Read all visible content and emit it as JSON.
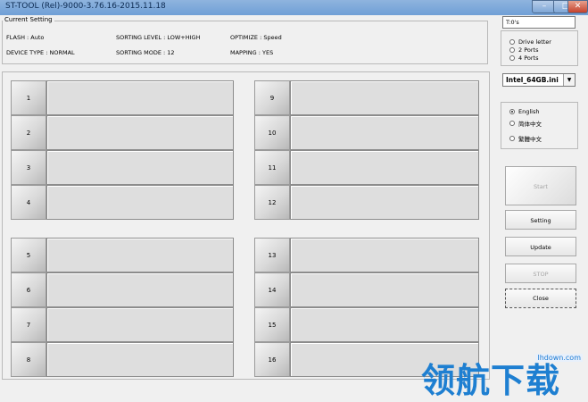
{
  "window": {
    "title": "ST-TOOL (Rel)-9000-3.76.16-2015.11.18",
    "minimize_glyph": "–",
    "maximize_glyph": "□",
    "close_glyph": "✕"
  },
  "current_setting": {
    "label": "Current Setting",
    "flash": "FLASH : Auto",
    "sorting_level": "SORTING LEVEL : LOW+HIGH",
    "optimize": "OPTIMIZE : Speed",
    "device_type": "DEVICE TYPE : NORMAL",
    "sorting_mode": "SORTING MODE : 12",
    "mapping": "MAPPING : YES"
  },
  "timer": {
    "value": "T:0's"
  },
  "port_mode": {
    "options": [
      "Drive letter",
      "2 Ports",
      "4 Ports"
    ],
    "selected_index": -1
  },
  "ini_select": {
    "value": "Intel_64GB.ini"
  },
  "language": {
    "options": [
      "English",
      "简体中文",
      "繁體中文"
    ],
    "selected_index": 0
  },
  "buttons": {
    "start": "Start",
    "setting": "Setting",
    "update": "Update",
    "stop": "STOP",
    "close": "Close"
  },
  "ports": [
    "1",
    "2",
    "3",
    "4",
    "5",
    "6",
    "7",
    "8",
    "9",
    "10",
    "11",
    "12",
    "13",
    "14",
    "15",
    "16"
  ],
  "watermark": {
    "url": "lhdown.com",
    "text": "领航下载"
  }
}
